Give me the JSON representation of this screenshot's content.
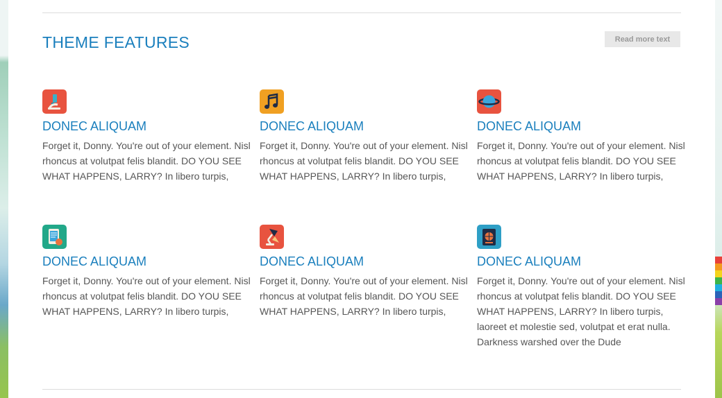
{
  "section": {
    "title": "THEME FEATURES",
    "read_more_label": "Read more text"
  },
  "features": [
    {
      "icon": "microscope-icon",
      "icon_color": "#e8533f",
      "title": "DONEC ALIQUAM",
      "text": "Forget it, Donny. You're out of your element. Nisl rhoncus at volutpat felis blandit. DO YOU SEE WHAT HAPPENS, LARRY? In libero turpis,"
    },
    {
      "icon": "music-note-icon",
      "icon_color": "#f0a022",
      "title": "DONEC ALIQUAM",
      "text": "Forget it, Donny. You're out of your element. Nisl rhoncus at volutpat felis blandit. DO YOU SEE WHAT HAPPENS, LARRY? In libero turpis,"
    },
    {
      "icon": "planet-icon",
      "icon_color": "#e8533f",
      "title": "DONEC ALIQUAM",
      "text": "Forget it, Donny. You're out of your element. Nisl rhoncus at volutpat felis blandit. DO YOU SEE WHAT HAPPENS, LARRY? In libero turpis,"
    },
    {
      "icon": "tablet-icon",
      "icon_color": "#22a889",
      "title": "DONEC ALIQUAM",
      "text": "Forget it, Donny. You're out of your element. Nisl rhoncus at volutpat felis blandit. DO YOU SEE WHAT HAPPENS, LARRY? In libero turpis,"
    },
    {
      "icon": "desk-lamp-icon",
      "icon_color": "#e8533f",
      "title": "DONEC ALIQUAM",
      "text": "Forget it, Donny. You're out of your element. Nisl rhoncus at volutpat felis blandit. DO YOU SEE WHAT HAPPENS, LARRY? In libero turpis,"
    },
    {
      "icon": "passport-icon",
      "icon_color": "#2e9fc6",
      "title": "DONEC ALIQUAM",
      "text": "Forget it, Donny. You're out of your element. Nisl rhoncus at volutpat felis blandit. DO YOU SEE WHAT HAPPENS, LARRY? In libero turpis, laoreet et molestie sed, volutpat et erat nulla. Darkness warshed over the Dude"
    }
  ]
}
